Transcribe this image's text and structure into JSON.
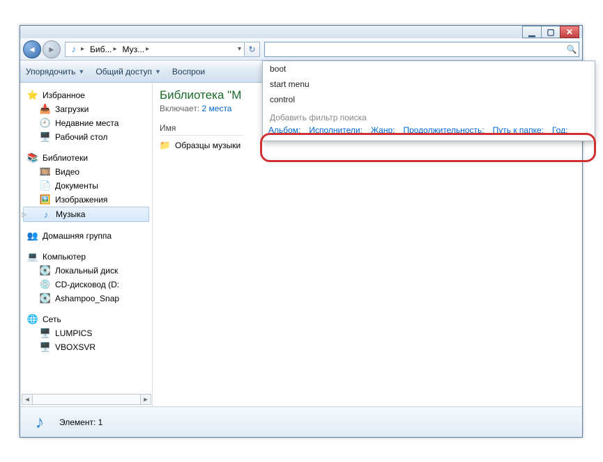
{
  "window": {
    "breadcrumbs": [
      "Биб...",
      "Муз..."
    ],
    "search_placeholder": ""
  },
  "toolbar": {
    "organize": "Упорядочить",
    "share": "Общий доступ",
    "play": "Воспрои"
  },
  "sidebar": {
    "favorites": {
      "label": "Избранное",
      "items": [
        "Загрузки",
        "Недавние места",
        "Рабочий стол"
      ]
    },
    "libraries": {
      "label": "Библиотеки",
      "items": [
        "Видео",
        "Документы",
        "Изображения",
        "Музыка"
      ],
      "selected_index": 3
    },
    "homegroup": {
      "label": "Домашняя группа"
    },
    "computer": {
      "label": "Компьютер",
      "items": [
        "Локальный диск",
        "CD-дисковод (D:",
        "Ashampoo_Snap"
      ]
    },
    "network": {
      "label": "Сеть",
      "items": [
        "LUMPICS",
        "VBOXSVR"
      ]
    }
  },
  "main": {
    "library_title": "Библиотека \"М",
    "includes_label": "Включает:",
    "includes_link": "2 места",
    "column_name": "Имя",
    "files": [
      "Образцы музыки"
    ]
  },
  "search_dropdown": {
    "history": [
      "boot",
      "start menu",
      "control"
    ],
    "filter_label": "Добавить фильтр поиска",
    "filters": [
      "Альбом:",
      "Исполнители:",
      "Жанр:",
      "Продолжительность:",
      "Путь к папке:",
      "Год:"
    ]
  },
  "statusbar": {
    "label": "Элемент: 1"
  }
}
